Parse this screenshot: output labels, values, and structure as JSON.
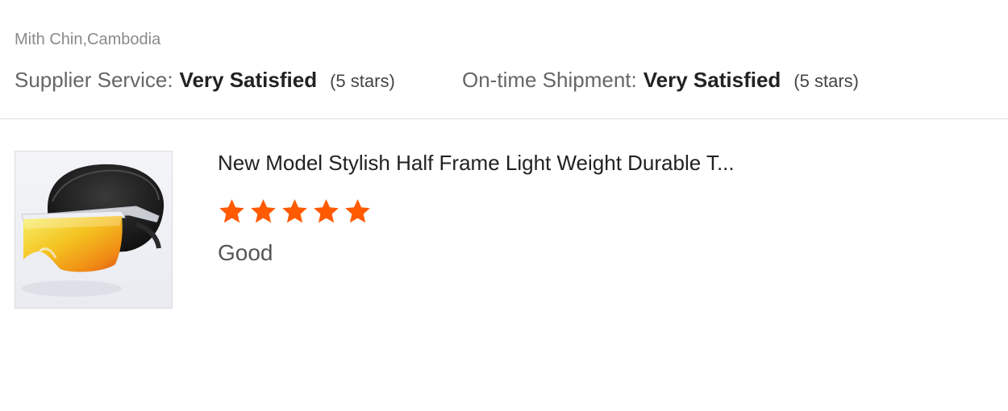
{
  "reviewer": {
    "location": "Mith Chin,Cambodia"
  },
  "ratings": {
    "supplier_service": {
      "label": "Supplier Service:",
      "value": "Very Satisfied",
      "count": "(5 stars)"
    },
    "on_time_shipment": {
      "label": "On-time Shipment:",
      "value": "Very Satisfied",
      "count": "(5 stars)"
    }
  },
  "product": {
    "title": "New Model Stylish Half Frame Light Weight Durable T...",
    "image_icon": "sunglasses-product-photo",
    "stars": 5,
    "stars_max": 5,
    "review_text": "Good"
  },
  "colors": {
    "star": "#ff5a00",
    "divider": "#e1e1e1"
  }
}
